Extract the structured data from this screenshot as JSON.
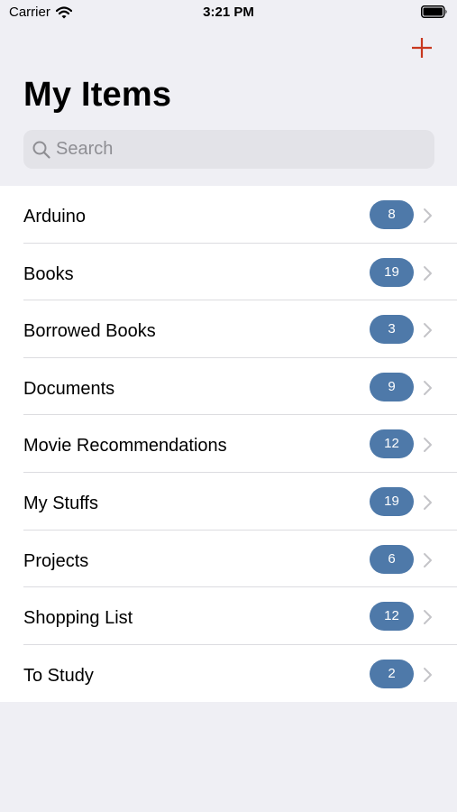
{
  "status_bar": {
    "carrier": "Carrier",
    "time": "3:21 PM"
  },
  "header": {
    "title": "My Items",
    "add_icon": "plus-icon"
  },
  "search": {
    "placeholder": "Search",
    "value": "",
    "icon": "search-icon"
  },
  "colors": {
    "accent": "#c8381f",
    "badge": "#4e79a9",
    "background": "#efeff4"
  },
  "items": [
    {
      "label": "Arduino",
      "count": "8"
    },
    {
      "label": "Books",
      "count": "19"
    },
    {
      "label": "Borrowed Books",
      "count": "3"
    },
    {
      "label": "Documents",
      "count": "9"
    },
    {
      "label": "Movie Recommendations",
      "count": "12"
    },
    {
      "label": "My Stuffs",
      "count": "19"
    },
    {
      "label": "Projects",
      "count": "6"
    },
    {
      "label": "Shopping List",
      "count": "12"
    },
    {
      "label": "To Study",
      "count": "2"
    }
  ]
}
